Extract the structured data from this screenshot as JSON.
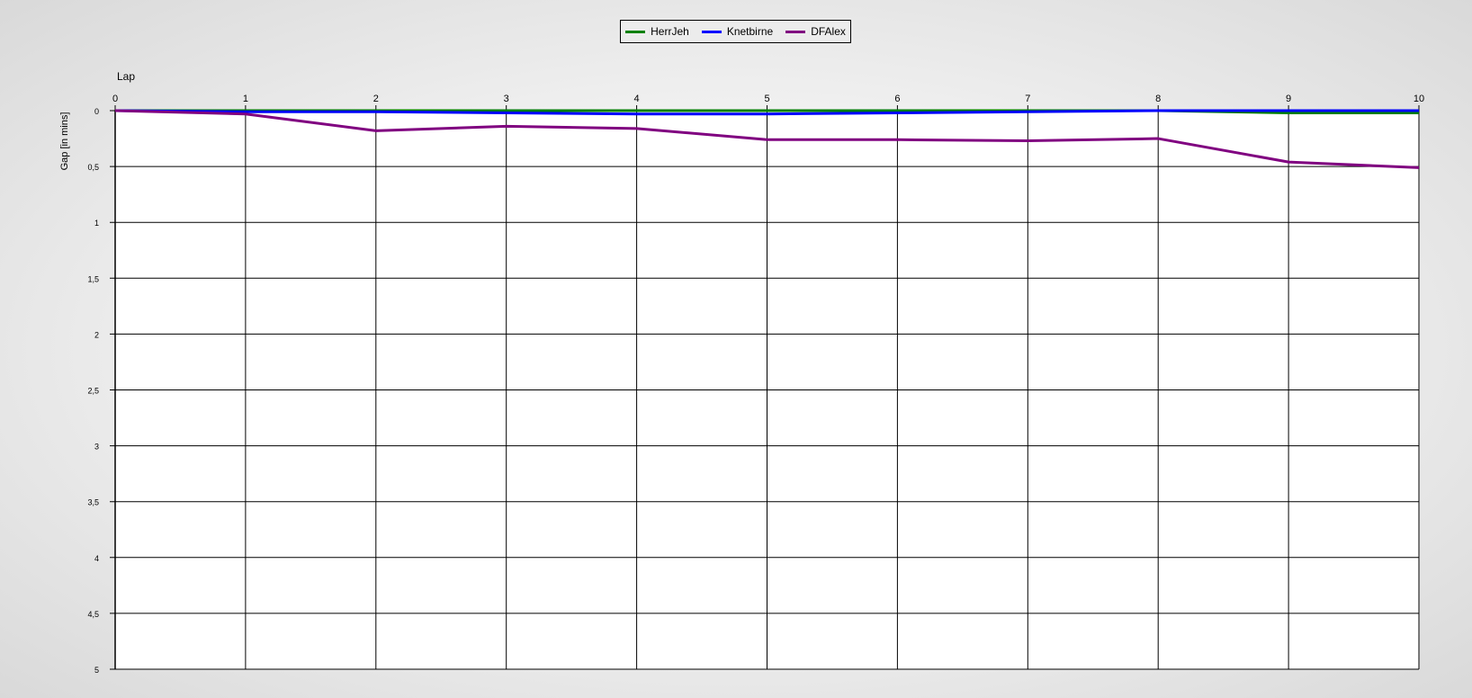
{
  "chart_data": {
    "type": "line",
    "title": "",
    "xlabel": "Lap",
    "ylabel": "Gap [in mins]",
    "x": [
      0,
      1,
      2,
      3,
      4,
      5,
      6,
      7,
      8,
      9,
      10
    ],
    "xlim": [
      0,
      10
    ],
    "ylim": [
      0,
      5
    ],
    "y_inverted": true,
    "x_axis_position": "top",
    "x_ticks": [
      "0",
      "1",
      "2",
      "3",
      "4",
      "5",
      "6",
      "7",
      "8",
      "9",
      "10"
    ],
    "y_ticks": [
      {
        "value": 0,
        "label": "0"
      },
      {
        "value": 0.5,
        "label": "0,5"
      },
      {
        "value": 1,
        "label": "1"
      },
      {
        "value": 1.5,
        "label": "1,5"
      },
      {
        "value": 2,
        "label": "2"
      },
      {
        "value": 2.5,
        "label": "2,5"
      },
      {
        "value": 3,
        "label": "3"
      },
      {
        "value": 3.5,
        "label": "3,5"
      },
      {
        "value": 4,
        "label": "4"
      },
      {
        "value": 4.5,
        "label": "4,5"
      },
      {
        "value": 5,
        "label": "5"
      }
    ],
    "grid": true,
    "legend_position": "top-center",
    "series": [
      {
        "name": "HerrJeh",
        "color": "#008000",
        "values": [
          0,
          0,
          0,
          0,
          0,
          0,
          0,
          0,
          0,
          0.02,
          0.02
        ]
      },
      {
        "name": "Knetbirne",
        "color": "#0000ff",
        "values": [
          0,
          0.01,
          0.01,
          0.02,
          0.03,
          0.03,
          0.02,
          0.01,
          0,
          0,
          0
        ]
      },
      {
        "name": "DFAlex",
        "color": "#800080",
        "values": [
          0,
          0.03,
          0.18,
          0.14,
          0.16,
          0.26,
          0.26,
          0.27,
          0.25,
          0.46,
          0.51
        ]
      }
    ]
  }
}
